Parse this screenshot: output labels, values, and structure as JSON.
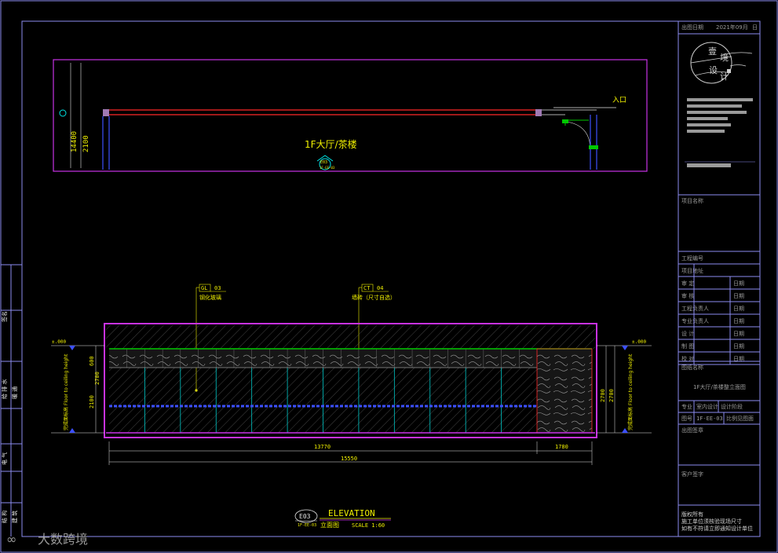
{
  "title_block": {
    "date_label": "出图日期",
    "date_value": "2021年09月",
    "date_suffix": "日",
    "logo_text": "壹境设计",
    "project_name_label": "项目名称",
    "rows": [
      {
        "label": "工程编号",
        "value": ""
      },
      {
        "label": "项目地址",
        "value": ""
      },
      {
        "label": "审 定",
        "value": "日期"
      },
      {
        "label": "审 核",
        "value": "日期"
      },
      {
        "label": "工程负责人",
        "value": "日期"
      },
      {
        "label": "专业负责人",
        "value": "日期"
      },
      {
        "label": "设 计",
        "value": "日期"
      },
      {
        "label": "制 图",
        "value": "日期"
      },
      {
        "label": "校 对",
        "value": "日期"
      }
    ],
    "drawing_name_label": "图纸名称",
    "drawing_name_value": "1F大厅/茶楼整立面图",
    "specialty_label": "专业",
    "specialty_value": "室内设计",
    "stage_label": "设计阶段",
    "figure_no_label": "图号",
    "figure_no_value": "1F-EE-03",
    "scale_label": "比例见图面",
    "issue_label": "出图签章",
    "client_label": "客户签字",
    "notes": [
      "版权所有",
      "施工单位须核验现场尺寸",
      "如有不符请立即通知设计单位"
    ]
  },
  "left_strip": [
    "签名",
    "给 排 水",
    "暖 通",
    "电 气",
    "结 构",
    "建 筑"
  ],
  "plan": {
    "dim_vertical_1": "14400",
    "dim_vertical_2": "2100",
    "room_label": "1F大厅/茶楼",
    "door_label": "入口",
    "section_mark": "E03",
    "section_sub": "1F-EE-03"
  },
  "elevation": {
    "callout_1_code": "GL",
    "callout_1_no": "03",
    "callout_1_text": "钢化玻璃",
    "callout_2_code": "CT",
    "callout_2_no": "04",
    "callout_2_text": "墙砖（尺寸自选）",
    "level_left": "±.000",
    "level_right": "±.000",
    "side_text_left": "完成面标高 Floor to ceiling height",
    "side_text_right": "完成面标高 Floor to ceiling height",
    "dim_left_top": "600",
    "dim_left_mid": "2700",
    "dim_left_bottom": "2100",
    "dim_right_1": "2700",
    "dim_right_2": "2700",
    "dim_bottom_1": "13770",
    "dim_bottom_2": "1780",
    "dim_total": "15550"
  },
  "footer": {
    "tag": "E03",
    "tag_sub": "1F-EE-03",
    "title_en": "ELEVATION",
    "title_cn": "立面图",
    "scale": "SCALE 1:60"
  },
  "watermark": "大数跨境",
  "colors": {
    "frame": "#8c8cf0",
    "magenta": "#c832e6",
    "yellow": "#f0f000",
    "cyan": "#00e6e6",
    "green": "#00c800",
    "red": "#ff2828",
    "blue": "#3c50ff",
    "white": "#e6e6e6",
    "gray": "#9a9a9a"
  }
}
